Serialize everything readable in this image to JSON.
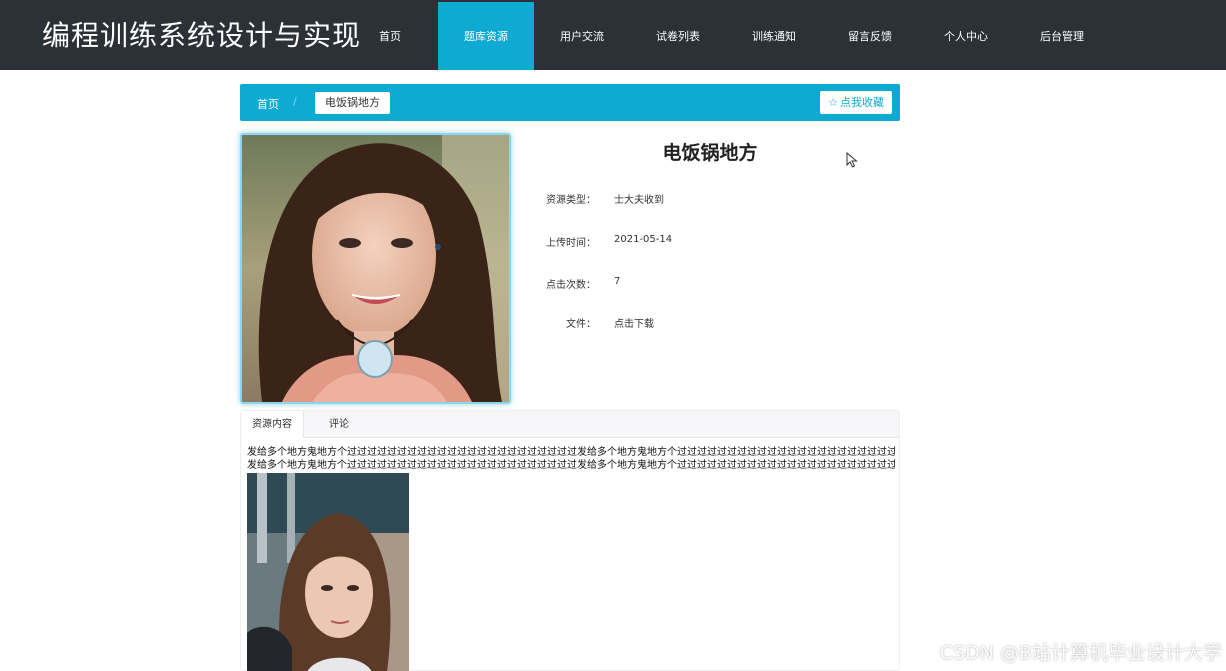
{
  "header": {
    "site_title": "编程训练系统设计与实现",
    "nav": [
      {
        "label": "首页"
      },
      {
        "label": "题库资源"
      },
      {
        "label": "用户交流"
      },
      {
        "label": "试卷列表"
      },
      {
        "label": "训练通知"
      },
      {
        "label": "留言反馈"
      },
      {
        "label": "个人中心"
      },
      {
        "label": "后台管理"
      }
    ],
    "active_index": 1
  },
  "breadcrumb": {
    "home": "首页",
    "separator": "/",
    "current": "电饭锅地方",
    "favorite_label": "点我收藏",
    "favorite_icon": "star-outline-icon"
  },
  "detail": {
    "title": "电饭锅地方",
    "fields": [
      {
        "label": "资源类型：",
        "value": "士大夫收到"
      },
      {
        "label": "上传时间：",
        "value": "2021-05-14"
      },
      {
        "label": "点击次数：",
        "value": "7"
      },
      {
        "label": "文件：",
        "value": "点击下载"
      }
    ]
  },
  "tabs": {
    "items": [
      {
        "label": "资源内容"
      },
      {
        "label": "评论"
      }
    ],
    "active_index": 0
  },
  "content": {
    "line1": "发给多个地方鬼地方个过过过过过过过过过过过过过过过过过过过过过过过发给多个地方鬼地方个过过过过过过过过过过过过过过过过过过过过过过过",
    "line2": "发给多个地方鬼地方个过过过过过过过过过过过过过过过过过过过过过过过发给多个地方鬼地方个过过过过过过过过过过过过过过过过过过过过过过过"
  },
  "watermark": "CSDN @B站计算机毕业设计大学",
  "colors": {
    "header_bg": "#2c3138",
    "accent": "#0eaad1"
  }
}
